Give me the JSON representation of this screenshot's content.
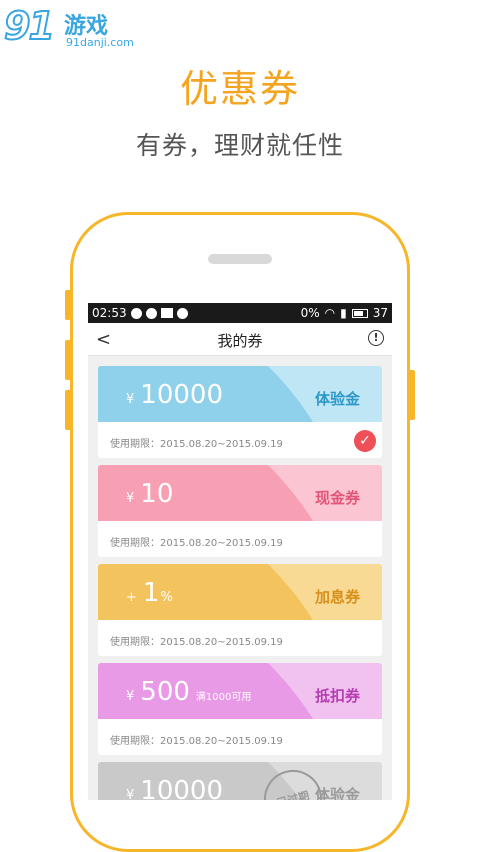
{
  "watermark": {
    "logo_number": "91",
    "logo_text": "游戏",
    "url": "91danji.com"
  },
  "promo": {
    "title": "优惠券",
    "subtitle": "有券，理财就任性"
  },
  "statusbar": {
    "time": "02:53",
    "icons_left": [
      "chat-icon",
      "k-icon",
      "image-icon",
      "check-icon"
    ],
    "signal_text": "0%",
    "battery": "37"
  },
  "navbar": {
    "back": "<",
    "title": "我的券",
    "info": "!"
  },
  "coupons": [
    {
      "symbol": "¥",
      "value": "10000",
      "suffix": "",
      "note": "",
      "type": "体验金",
      "validity": "使用期限：2015.08.20~2015.09.19",
      "color_main": "#8fd0ea",
      "color_light": "#bfe6f5",
      "type_color": "#2e98c9",
      "selected": true
    },
    {
      "symbol": "¥",
      "value": "10",
      "suffix": "",
      "note": "",
      "type": "现金券",
      "validity": "使用期限：2015.08.20~2015.09.19",
      "color_main": "#f7a0b3",
      "color_light": "#fbc6d1",
      "type_color": "#e35479",
      "selected": false
    },
    {
      "symbol": "+",
      "value": "1",
      "suffix": "%",
      "note": "",
      "type": "加息券",
      "validity": "使用期限：2015.08.20~2015.09.19",
      "color_main": "#f3c45e",
      "color_light": "#f8da94",
      "type_color": "#d8901a",
      "selected": false
    },
    {
      "symbol": "¥",
      "value": "500",
      "suffix": "",
      "note": "满1000可用",
      "type": "抵扣券",
      "validity": "使用期限：2015.08.20~2015.09.19",
      "color_main": "#e89ae6",
      "color_light": "#f1c2f0",
      "type_color": "#b53fb1",
      "selected": false
    },
    {
      "symbol": "¥",
      "value": "10000",
      "suffix": "",
      "note": "",
      "type": "体验金",
      "validity": "",
      "color_main": "#c9c9c9",
      "color_light": "#dcdcdc",
      "type_color": "#9a9a9a",
      "selected": false,
      "stamp": "已过期"
    }
  ],
  "selected_mark": "✓"
}
